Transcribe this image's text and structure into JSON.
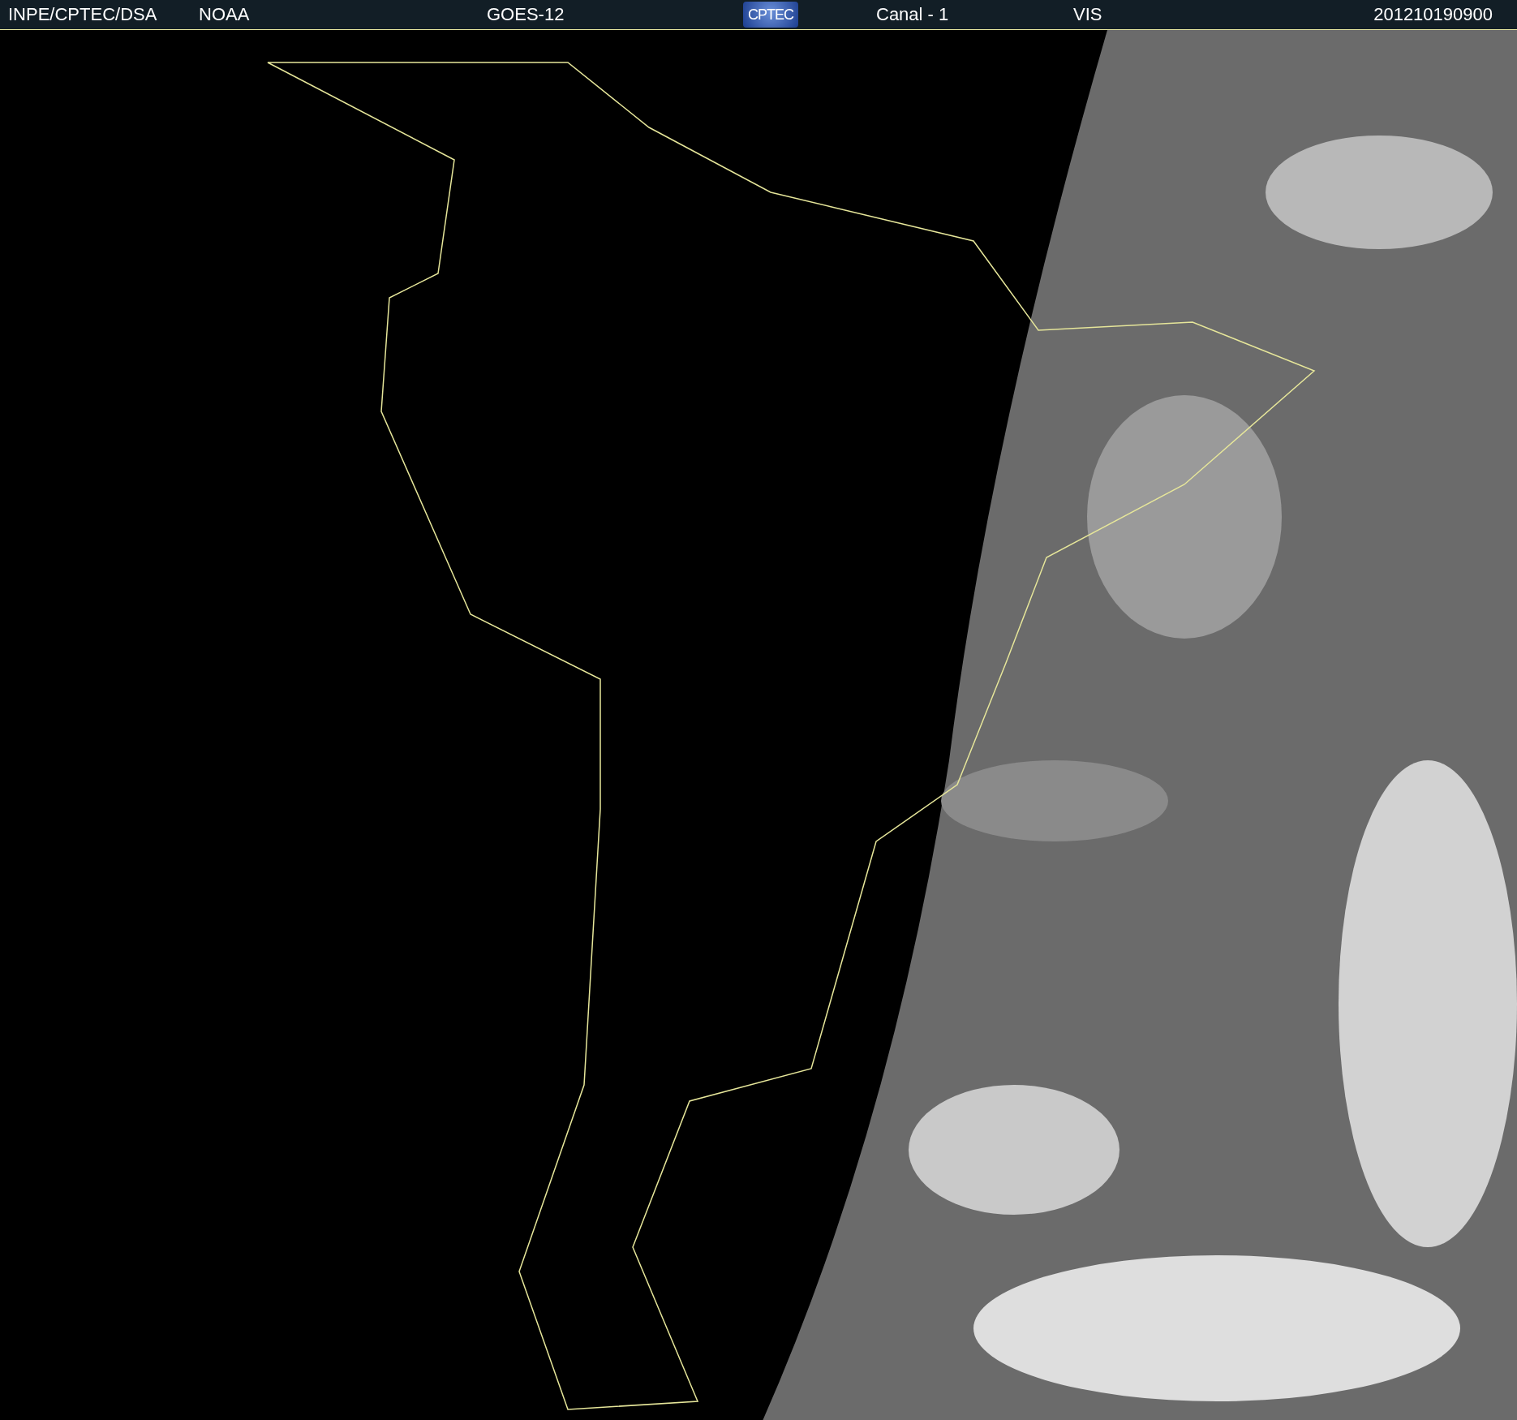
{
  "header": {
    "labels": [
      "INPE/CPTEC/DSA",
      "NOAA",
      "GOES-12"
    ],
    "logo_text": "CPTEC",
    "channel": "Canal - 1",
    "band": "VIS",
    "timestamp": "201210190900"
  }
}
